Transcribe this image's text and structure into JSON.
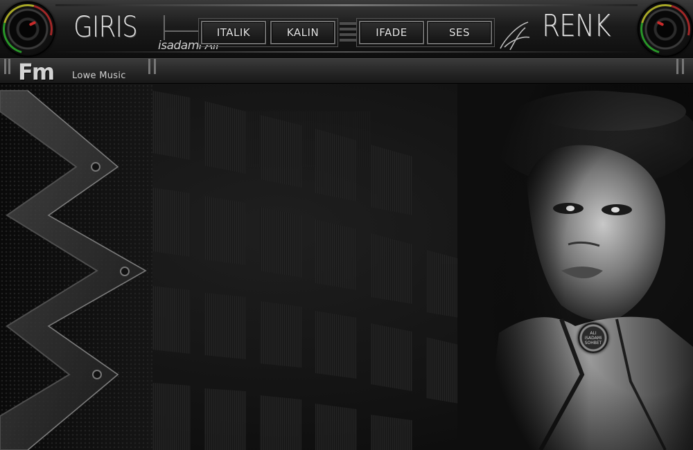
{
  "header": {
    "logo_left": "GIRIS",
    "logo_right": "RENK",
    "signature": "isadami Ali",
    "buttons": {
      "italik": "ITALIK",
      "kalin": "KALIN",
      "ifade": "IFADE",
      "ses": "SES"
    }
  },
  "subbar": {
    "fm_logo": "Fm",
    "subtitle": "Lowe Music"
  },
  "badge": {
    "line1": "ALI",
    "line2": "iSADAMi",
    "line3": "SOHBET"
  },
  "colors": {
    "vu_green": "#2ba52b",
    "vu_yellow": "#b8b82a",
    "vu_red": "#c82a2a"
  }
}
